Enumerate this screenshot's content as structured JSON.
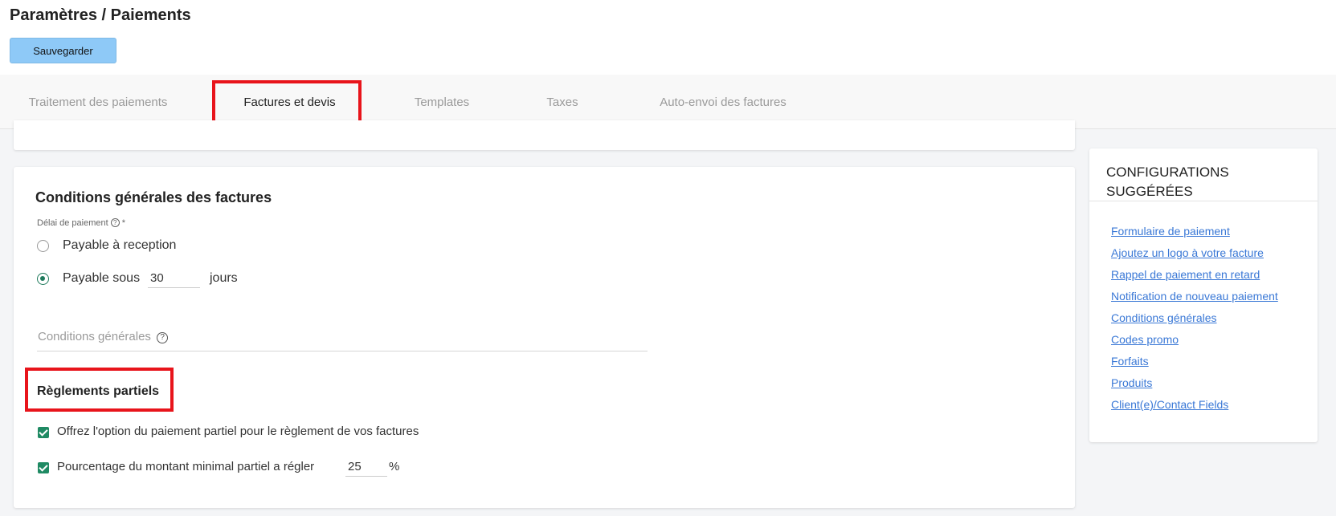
{
  "header": {
    "title": "Paramètres / Paiements",
    "save_label": "Sauvegarder"
  },
  "tabs": [
    {
      "label": "Traitement des paiements",
      "active": false
    },
    {
      "label": "Factures et devis",
      "active": true
    },
    {
      "label": "Templates",
      "active": false
    },
    {
      "label": "Taxes",
      "active": false
    },
    {
      "label": "Auto-envoi des factures",
      "active": false
    }
  ],
  "terms": {
    "title": "Conditions générales des factures",
    "delay_label": "Délai de paiement",
    "required_mark": "*",
    "option_receipt": "Payable à reception",
    "option_within": "Payable sous",
    "days_value": "30",
    "days_unit": "jours",
    "conditions_placeholder": "Conditions générales",
    "selected_option": "Payable sous"
  },
  "partial": {
    "title": "Règlements partiels",
    "option_offer": "Offrez l'option du paiement partiel pour le règlement de vos factures",
    "option_offer_checked": true,
    "option_percent": "Pourcentage du montant minimal partiel a régler",
    "option_percent_checked": true,
    "percent_value": "25",
    "percent_unit": "%"
  },
  "sidebar": {
    "title": "CONFIGURATIONS SUGGÉRÉES",
    "links": [
      "Formulaire de paiement",
      "Ajoutez un logo à votre facture",
      "Rappel de paiement en retard",
      "Notification de nouveau paiement",
      "Conditions générales",
      "Codes promo",
      "Forfaits",
      "Produits",
      "Client(e)/Contact Fields"
    ]
  },
  "icons": {
    "help": "help-circle-icon",
    "radio": "radio-icon",
    "checkbox": "checkbox-checked-icon"
  },
  "colors": {
    "accent_blue": "#8ec9f7",
    "highlight_red": "#e8141b",
    "check_green": "#1f8a63",
    "link_blue": "#3a78d6"
  }
}
